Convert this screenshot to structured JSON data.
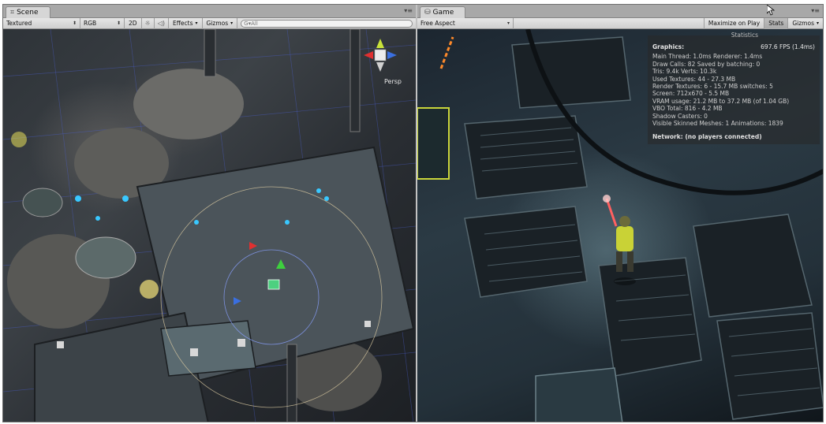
{
  "scene_panel": {
    "tab": {
      "icon": "scene-grid-icon",
      "label": "Scene"
    },
    "toolbar": {
      "draw_mode": "Textured",
      "render_mode": "RGB",
      "mode_2d": "2D",
      "lighting_icon": "sun-icon",
      "audio_icon": "speaker-icon",
      "effects": "Effects",
      "gizmos": "Gizmos",
      "search_placeholder": "G▾All"
    },
    "viewport": {
      "camera_mode": "Persp"
    }
  },
  "game_panel": {
    "tab": {
      "icon": "game-controller-icon",
      "label": "Game"
    },
    "toolbar": {
      "aspect": "Free Aspect",
      "maximize_on_play": "Maximize on Play",
      "stats": "Stats",
      "gizmos": "Gizmos"
    },
    "stats": {
      "title": "Statistics",
      "graphics_label": "Graphics:",
      "fps": "697.6 FPS (1.4ms)",
      "lines": [
        "Main Thread: 1.0ms  Renderer: 1.4ms",
        "Draw Calls: 82     Saved by batching: 0",
        "Tris: 9.4k      Verts: 10.3k",
        "Used Textures: 44 - 27.3 MB",
        "Render Textures: 6 - 15.7 MB   switches: 5",
        "Screen: 712x670 - 5.5 MB",
        "VRAM usage: 21.2 MB to 37.2 MB (of 1.04 GB)",
        "VBO Total: 816 - 4.2 MB",
        "Shadow Casters: 0",
        "Visible Skinned Meshes: 1     Animations: 1839"
      ],
      "network": "Network: (no players connected)"
    }
  },
  "colors": {
    "toolbar_bg": "#d9d9d9",
    "tab_bg": "#d6d6d6",
    "frame_bg": "#c2c2c2",
    "gizmo_x": "#e03030",
    "gizmo_y": "#7ecb3a",
    "gizmo_z": "#3a6fe0"
  }
}
